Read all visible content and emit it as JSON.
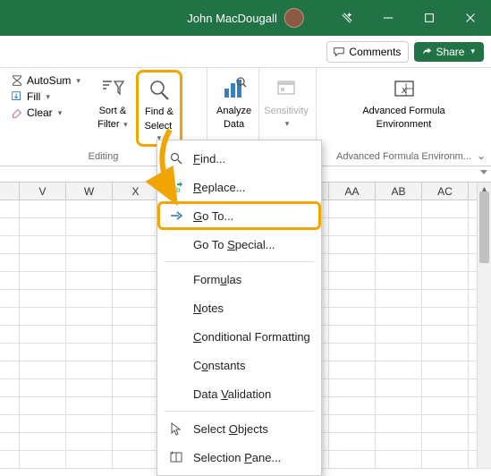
{
  "titlebar": {
    "user": "John MacDougall"
  },
  "actions": {
    "comments": "Comments",
    "share": "Share"
  },
  "ribbon": {
    "autosum": "AutoSum",
    "fill": "Fill",
    "clear": "Clear",
    "sort_filter_l1": "Sort &",
    "sort_filter_l2": "Filter",
    "find_select_l1": "Find &",
    "find_select_l2": "Select",
    "analyze_l1": "Analyze",
    "analyze_l2": "Data",
    "sensitivity": "Sensitivity",
    "afe_l1": "Advanced Formula",
    "afe_l2": "Environment",
    "group_editing": "Editing",
    "group_afe": "Advanced Formula Environm..."
  },
  "columns": [
    "V",
    "W",
    "X",
    "AA",
    "AB",
    "AC"
  ],
  "menu": {
    "find": "Find...",
    "replace": "Replace...",
    "goto": "Go To...",
    "goto_special": "Go To Special...",
    "formulas": "Formulas",
    "notes": "Notes",
    "cond_fmt": "Conditional Formatting",
    "constants": "Constants",
    "data_val": "Data Validation",
    "sel_objects": "Select Objects",
    "sel_pane": "Selection Pane..."
  }
}
